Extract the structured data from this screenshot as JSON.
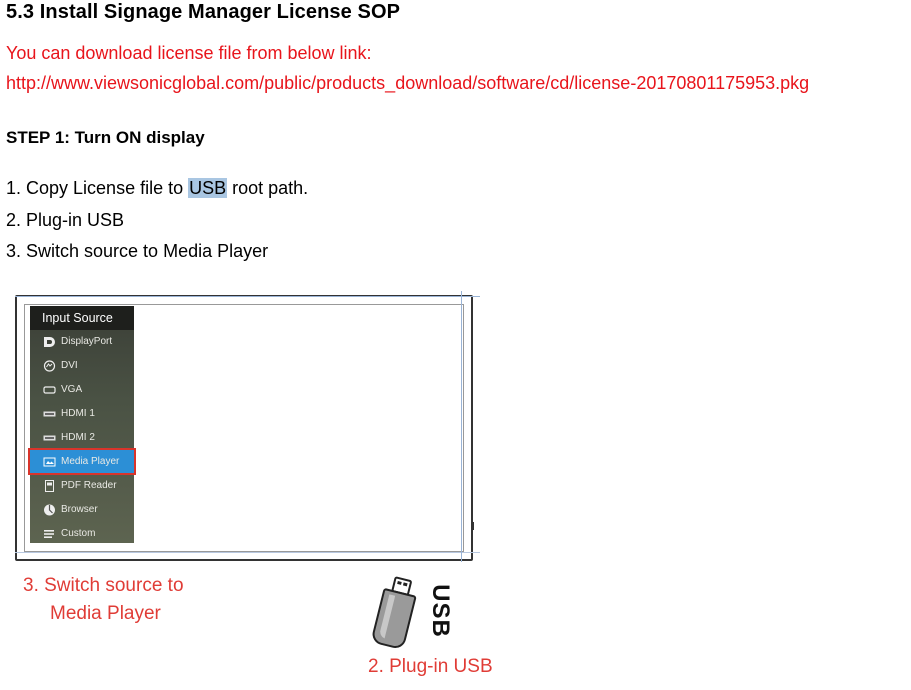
{
  "heading": "5.3 Install Signage Manager License SOP",
  "intro": "You can download license file from below link:",
  "link": "http://www.viewsonicglobal.com/public/products_download/software/cd/license-20170801175953.pkg",
  "step1_title": "STEP 1: Turn ON display",
  "steps": {
    "line1_before": "1. Copy License file to ",
    "line1_highlight": "USB",
    "line1_after": " root path.",
    "line2": "2. Plug-in USB",
    "line3": "3. Switch source to Media Player"
  },
  "menu": {
    "title": "Input Source",
    "selected_color": "#2c8fd6",
    "items": [
      {
        "label": "DisplayPort",
        "icon": "displayport-icon"
      },
      {
        "label": "DVI",
        "icon": "dvi-icon"
      },
      {
        "label": "VGA",
        "icon": "vga-icon"
      },
      {
        "label": "HDMI 1",
        "icon": "hdmi-icon"
      },
      {
        "label": "HDMI 2",
        "icon": "hdmi-icon"
      },
      {
        "label": "Media Player",
        "icon": "media-player-icon",
        "selected": true
      },
      {
        "label": "PDF Reader",
        "icon": "pdf-reader-icon"
      },
      {
        "label": "Browser",
        "icon": "browser-icon"
      },
      {
        "label": "Custom",
        "icon": "custom-icon"
      }
    ]
  },
  "captions": {
    "switch_line1": "3. Switch source to",
    "switch_line2": "Media Player",
    "usb_label": "USB",
    "plugin": "2. Plug-in USB"
  },
  "colors": {
    "red_text": "#e8141b",
    "caption_red": "#e03c36",
    "highlight": "#a9c6e2",
    "selection_border": "#d9342b"
  }
}
